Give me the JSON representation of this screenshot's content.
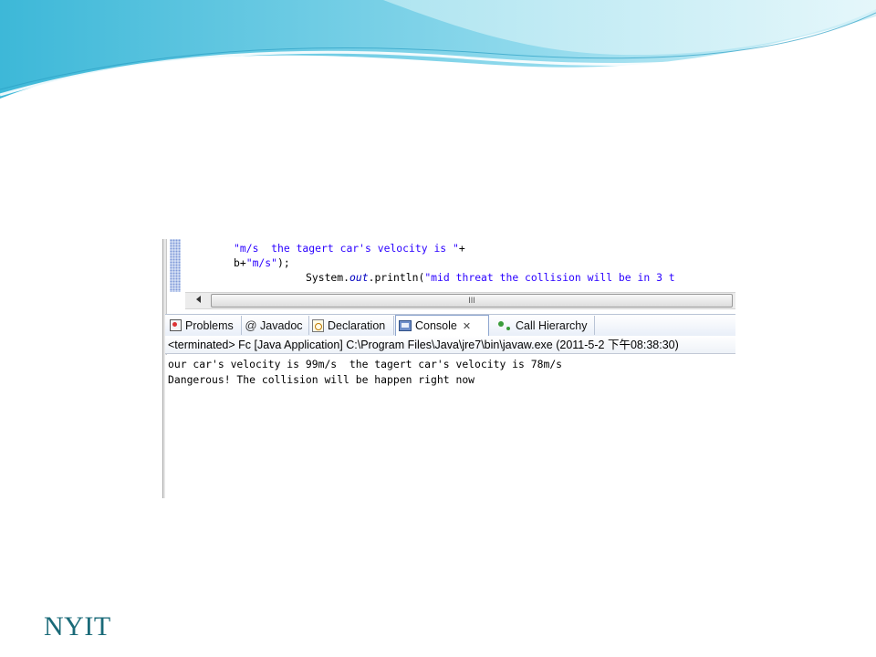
{
  "slide": {
    "brand": "NYIT"
  },
  "editor": {
    "lines": [
      {
        "str1": "\"m/s  the tagert car's velocity is \"",
        "rest": "+"
      },
      {
        "pre": "b+",
        "str1": "\"m/s\"",
        "rest": ");"
      },
      {
        "pre": "System.",
        "italic": "out",
        "mid": ".println(",
        "str1": "\"mid threat the collision will be in 3 t"
      }
    ],
    "scroll_grip": "III"
  },
  "tabs": [
    {
      "label": "Problems",
      "icon": "problems-icon"
    },
    {
      "label": "Javadoc",
      "icon": "at-sign-icon"
    },
    {
      "label": "Declaration",
      "icon": "declaration-icon"
    },
    {
      "label": "Console",
      "icon": "console-icon",
      "active": true
    },
    {
      "label": "Call Hierarchy",
      "icon": "call-hierarchy-icon"
    }
  ],
  "console": {
    "status": "<terminated> Fc [Java Application] C:\\Program Files\\Java\\jre7\\bin\\javaw.exe (2011-5-2 下午08:38:30)",
    "output": [
      "our car's velocity is 99m/s  the tagert car's velocity is 78m/s",
      "Dangerous! The collision will be happen right now"
    ]
  },
  "colors": {
    "string_literal": "#2a00ff",
    "brand": "#1a6a78"
  }
}
